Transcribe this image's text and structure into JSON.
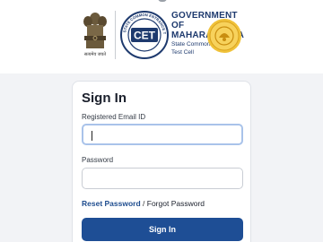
{
  "header": {
    "emblem_caption": "सत्यमेव जयते",
    "cet_logo_text": "CET",
    "cet_ring_text": "STATE COMMON ENTRANCE TEST CELL",
    "gov_line1": "GOVERNMENT",
    "gov_line2": "OF",
    "gov_line3": "MAHARASHTRA",
    "gov_sub1": "State Common Entrance",
    "gov_sub2": "Test Cell"
  },
  "form": {
    "title": "Sign In",
    "email_label": "Registered Email ID",
    "email_value": "",
    "password_label": "Password",
    "password_value": "",
    "reset_link": "Reset Password",
    "separator": " / ",
    "forgot_link": "Forgot Password",
    "submit_label": "Sign In"
  },
  "colors": {
    "brand_blue": "#1e4e95",
    "link_blue": "#1f4d8f",
    "heading_navy": "#1e3a6e",
    "focus_border": "#a9c3ea"
  }
}
